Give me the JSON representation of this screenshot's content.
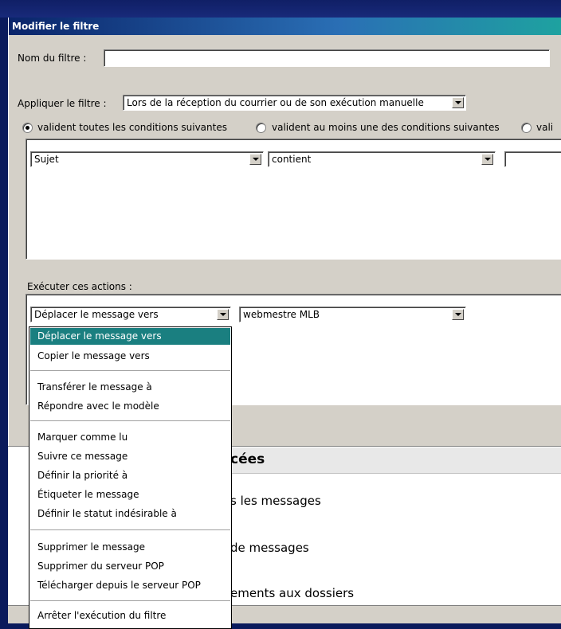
{
  "window": {
    "title": "Modifier le filtre"
  },
  "filter_name": {
    "label": "Nom du filtre :",
    "value": ""
  },
  "apply": {
    "label": "Appliquer le filtre :",
    "value": "Lors de la réception du courrier ou de son exécution manuelle"
  },
  "match": {
    "options": [
      {
        "label": "valident toutes les conditions suivantes",
        "selected": true
      },
      {
        "label": "valident au moins une des conditions suivantes",
        "selected": false
      },
      {
        "label": "vali",
        "selected": false
      }
    ]
  },
  "condition": {
    "field": "Sujet",
    "operator": "contient",
    "value": ""
  },
  "actions": {
    "label": "Exécuter ces actions :",
    "action_value": "Déplacer le message vers",
    "target_value": "webmestre MLB"
  },
  "dropdown_items": [
    "Déplacer le message vers",
    "Copier le message vers",
    "Transférer le message à",
    "Répondre avec le modèle",
    "Marquer comme lu",
    "Suivre ce message",
    "Définir la priorité à",
    "Étiqueter le message",
    "Définir le statut indésirable à",
    "Supprimer le message",
    "Supprimer du serveur POP",
    "Télécharger depuis le serveur POP",
    "Arrêter l'exécution du filtre"
  ],
  "background_page": {
    "heading_fragment": "cées",
    "line1": "s les messages",
    "line2": "de messages",
    "line3": "ements aux dossiers"
  },
  "colors": {
    "selection": "#1a7f80",
    "titlebar": "#0a246a",
    "desktop": "#0a1a5c"
  }
}
